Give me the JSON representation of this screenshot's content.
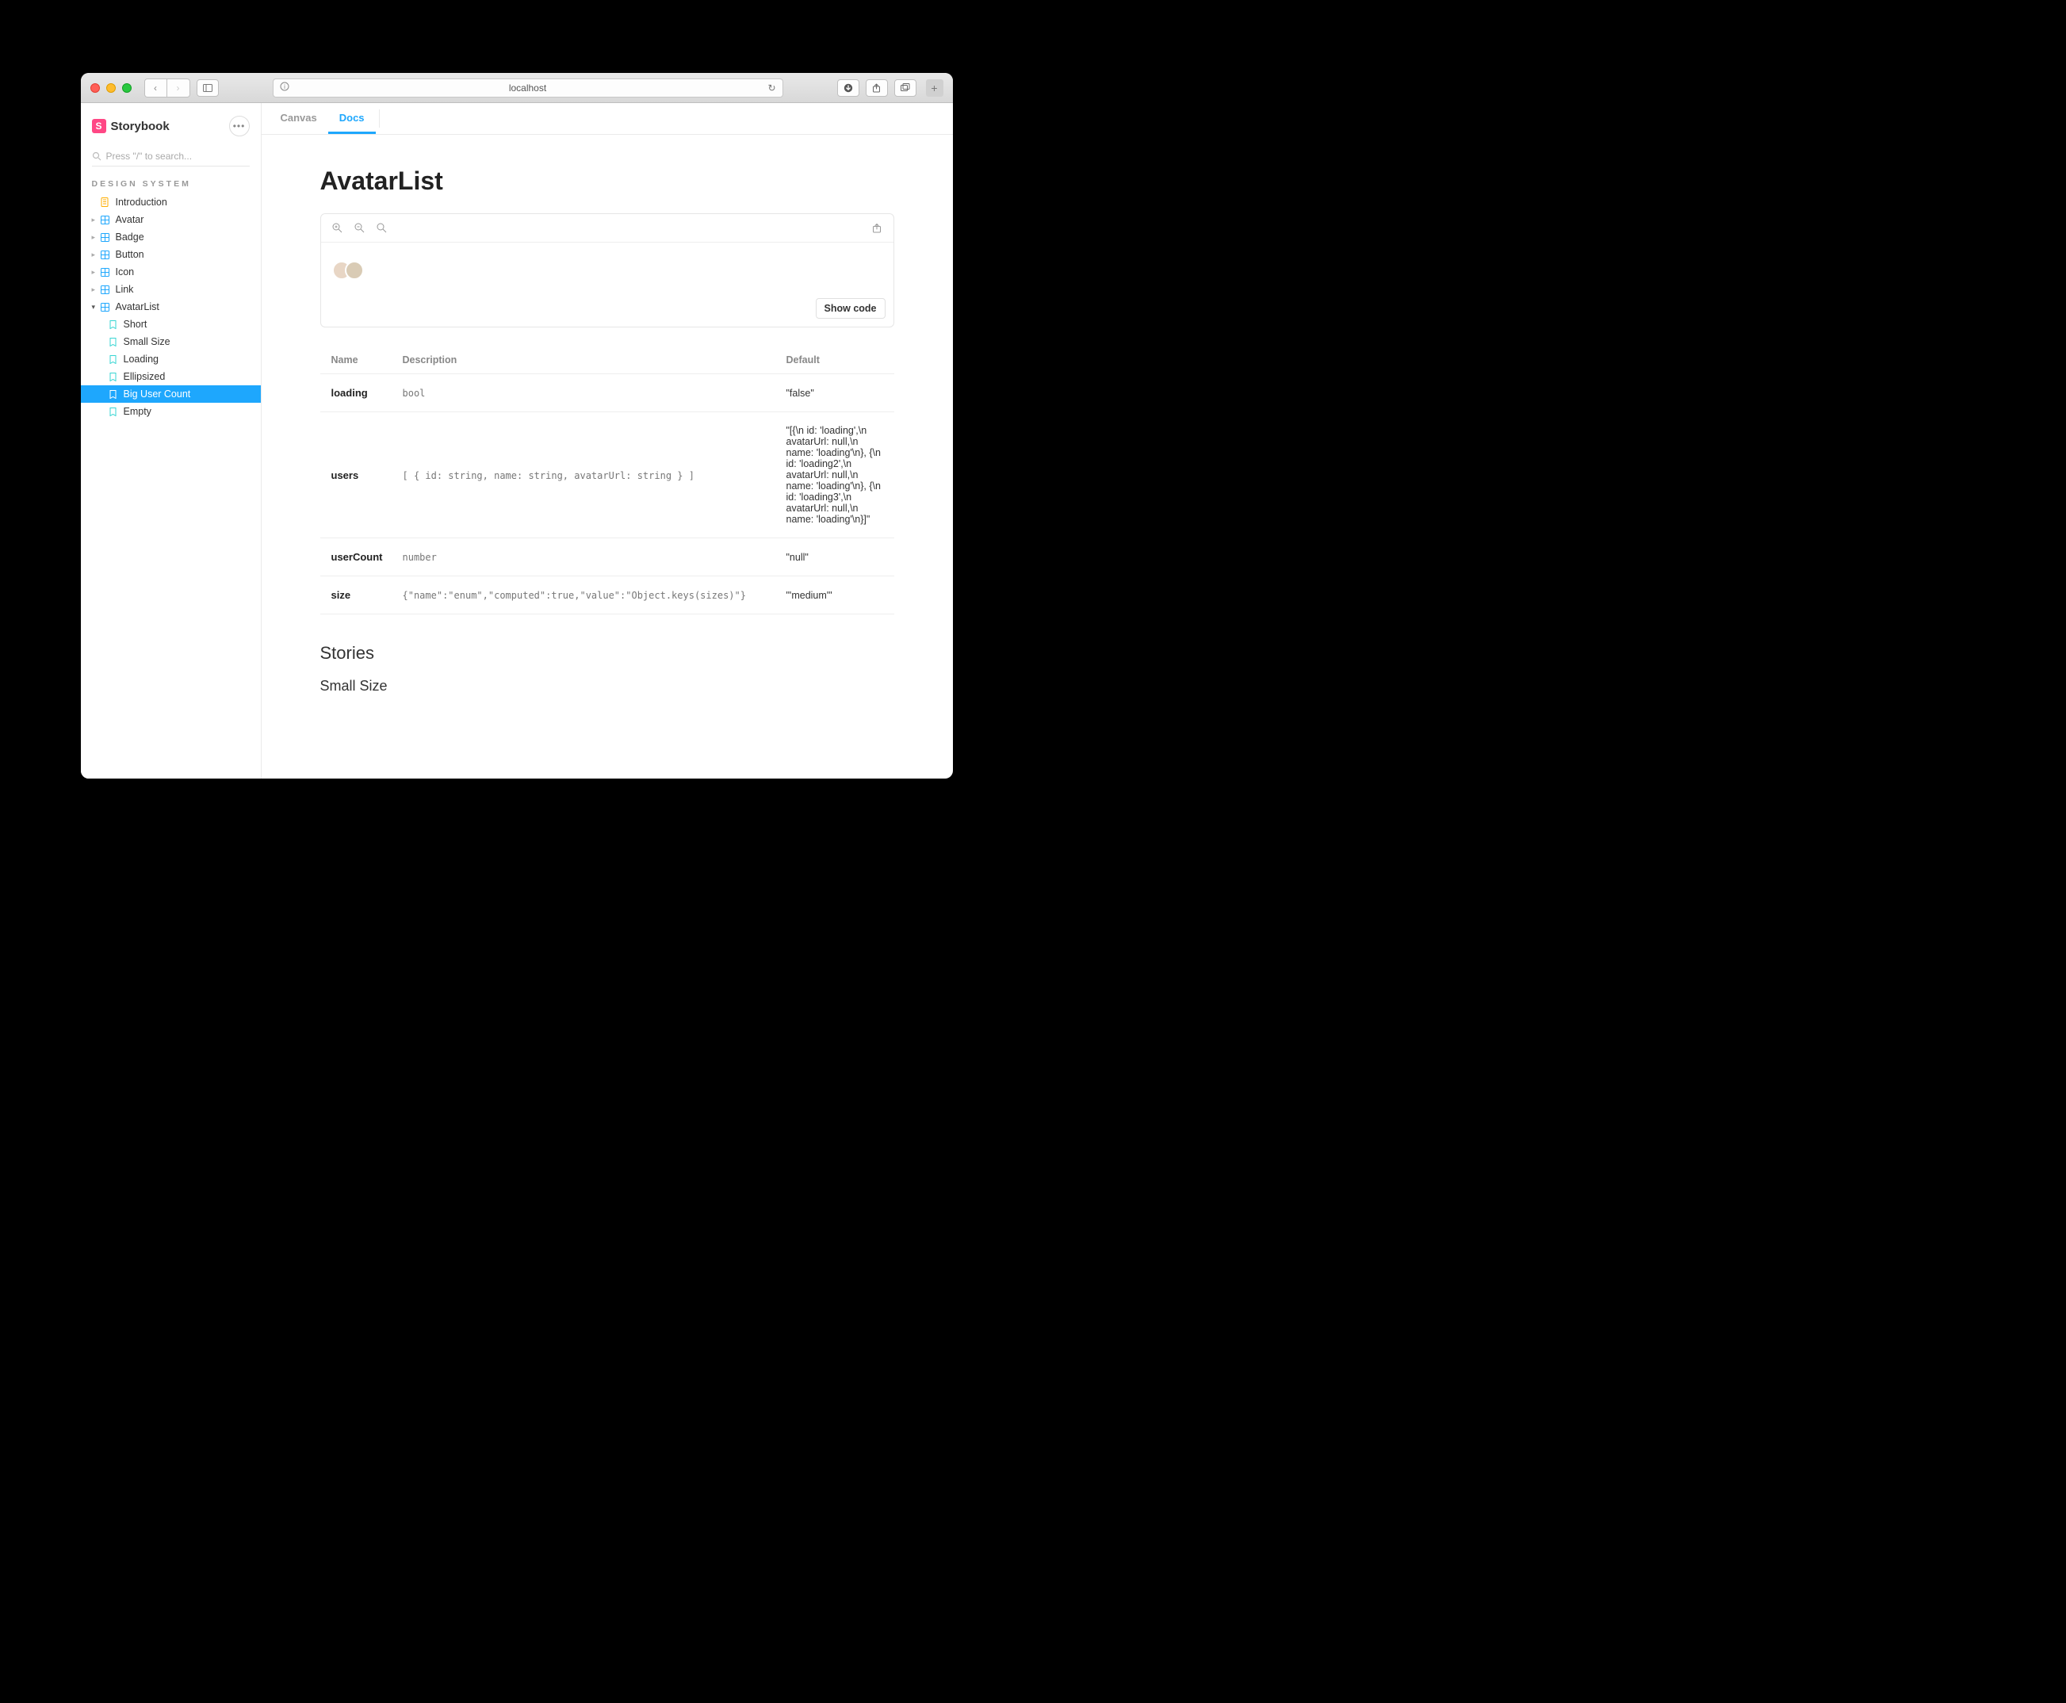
{
  "browser": {
    "address": "localhost"
  },
  "app": {
    "brand": "Storybook",
    "search_placeholder": "Press \"/\" to search...",
    "section_label": "DESIGN SYSTEM",
    "tree": {
      "intro": "Introduction",
      "components": [
        {
          "label": "Avatar",
          "expanded": false
        },
        {
          "label": "Badge",
          "expanded": false
        },
        {
          "label": "Button",
          "expanded": false
        },
        {
          "label": "Icon",
          "expanded": false
        },
        {
          "label": "Link",
          "expanded": false
        },
        {
          "label": "AvatarList",
          "expanded": true
        }
      ],
      "avatarlist_stories": [
        "Short",
        "Small Size",
        "Loading",
        "Ellipsized",
        "Big User Count",
        "Empty"
      ],
      "active_story": "Big User Count"
    },
    "tabs": {
      "canvas": "Canvas",
      "docs": "Docs"
    }
  },
  "doc": {
    "title": "AvatarList",
    "show_code": "Show code",
    "table": {
      "headers": {
        "name": "Name",
        "description": "Description",
        "default": "Default"
      },
      "rows": [
        {
          "name": "loading",
          "desc": "bool",
          "def": "\"false\""
        },
        {
          "name": "users",
          "desc": "[ { id: string, name: string, avatarUrl: string } ]",
          "def": "\"[{\\n id: 'loading',\\n avatarUrl: null,\\n name: 'loading'\\n}, {\\n id: 'loading2',\\n avatarUrl: null,\\n name: 'loading'\\n}, {\\n id: 'loading3',\\n avatarUrl: null,\\n name: 'loading'\\n}]\""
        },
        {
          "name": "userCount",
          "desc": "number",
          "def": "\"null\""
        },
        {
          "name": "size",
          "desc": "{\"name\":\"enum\",\"computed\":true,\"value\":\"Object.keys(sizes)\"}",
          "def": "\"'medium'\""
        }
      ]
    },
    "stories_heading": "Stories",
    "first_story_heading": "Small Size"
  }
}
